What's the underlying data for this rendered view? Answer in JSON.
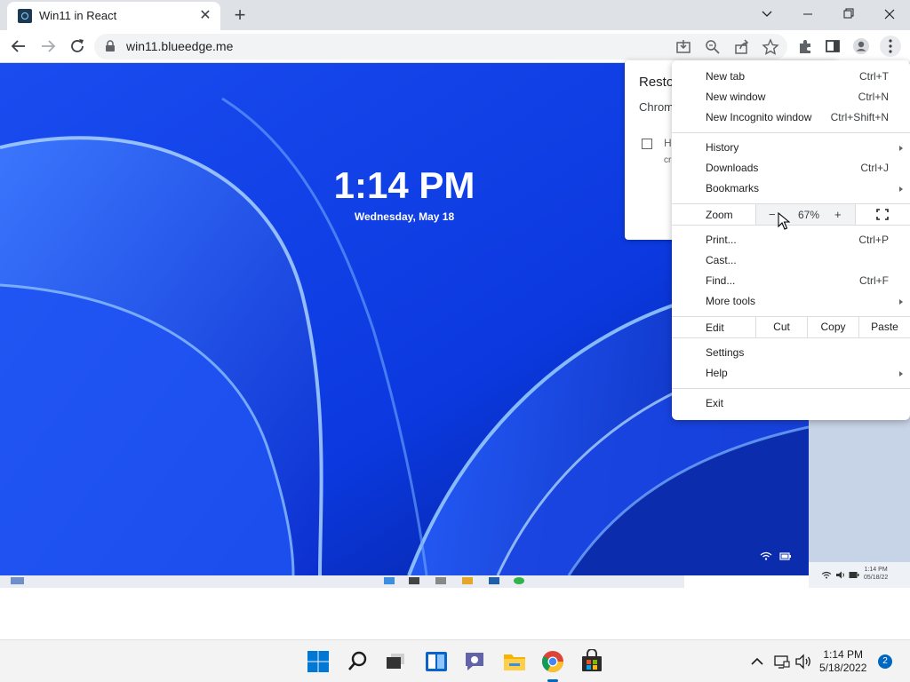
{
  "tab": {
    "title": "Win11 in React",
    "close": "✕"
  },
  "new_tab_symbol": "+",
  "window": {
    "controls": [
      "chevron-down-icon",
      "minimize-icon",
      "restore-icon",
      "close-icon"
    ]
  },
  "toolbar": {
    "url": "win11.blueedge.me",
    "icons": [
      "back-arrow-icon",
      "forward-arrow-icon",
      "reload-icon",
      "lock-icon",
      "install-icon",
      "zoom-icon",
      "share-icon",
      "star-icon",
      "extensions-icon",
      "side-panel-icon",
      "profile-icon",
      "kebab-menu-icon"
    ]
  },
  "lockscreen": {
    "time": "1:14 PM",
    "date": "Wednesday, May 18"
  },
  "restore_dialog": {
    "title": "Resto",
    "body": "Chrom",
    "checkbox_text": "H",
    "sub_text": "cr"
  },
  "menu": {
    "new_tab": {
      "label": "New tab",
      "shortcut": "Ctrl+T"
    },
    "new_window": {
      "label": "New window",
      "shortcut": "Ctrl+N"
    },
    "new_incognito": {
      "label": "New Incognito window",
      "shortcut": "Ctrl+Shift+N"
    },
    "history": {
      "label": "History"
    },
    "downloads": {
      "label": "Downloads",
      "shortcut": "Ctrl+J"
    },
    "bookmarks": {
      "label": "Bookmarks"
    },
    "zoom": {
      "label": "Zoom",
      "minus": "−",
      "value": "67%",
      "plus": "+"
    },
    "print": {
      "label": "Print...",
      "shortcut": "Ctrl+P"
    },
    "cast": {
      "label": "Cast..."
    },
    "find": {
      "label": "Find...",
      "shortcut": "Ctrl+F"
    },
    "more_tools": {
      "label": "More tools"
    },
    "edit": {
      "label": "Edit",
      "cut": "Cut",
      "copy": "Copy",
      "paste": "Paste"
    },
    "settings": {
      "label": "Settings"
    },
    "help": {
      "label": "Help"
    },
    "exit": {
      "label": "Exit"
    }
  },
  "mini_taskbar": {
    "time": "1:14 PM",
    "date": "05/18/22"
  },
  "taskbar": {
    "apps": [
      "windows-start-icon",
      "search-icon",
      "task-view-icon",
      "widgets-icon",
      "teams-chat-icon",
      "file-explorer-icon",
      "chrome-icon",
      "store-icon"
    ],
    "time": "1:14 PM",
    "date": "5/18/2022",
    "notifications": "2",
    "accent": "#0067c0"
  }
}
